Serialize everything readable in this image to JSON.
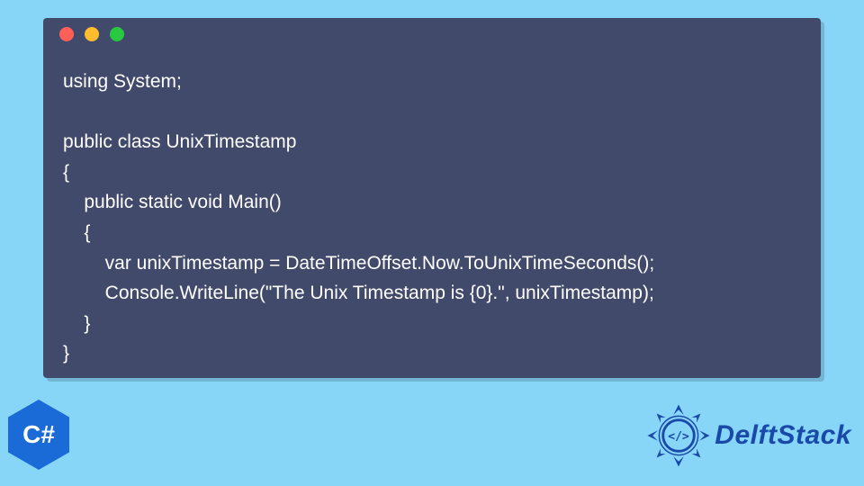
{
  "code": {
    "lines": [
      "using System;",
      "",
      "public class UnixTimestamp",
      "{",
      "    public static void Main()",
      "    {",
      "        var unixTimestamp = DateTimeOffset.Now.ToUnixTimeSeconds();",
      "        Console.WriteLine(\"The Unix Timestamp is {0}.\", unixTimestamp);",
      "    }",
      "}"
    ]
  },
  "badges": {
    "csharp": "C#",
    "brand": "DelftStack"
  },
  "colors": {
    "background": "#87d6f8",
    "window": "#424a6b",
    "code_text": "#ffffff",
    "csharp_hex": "#1a6bd8",
    "brand_text": "#1a4aa8"
  }
}
